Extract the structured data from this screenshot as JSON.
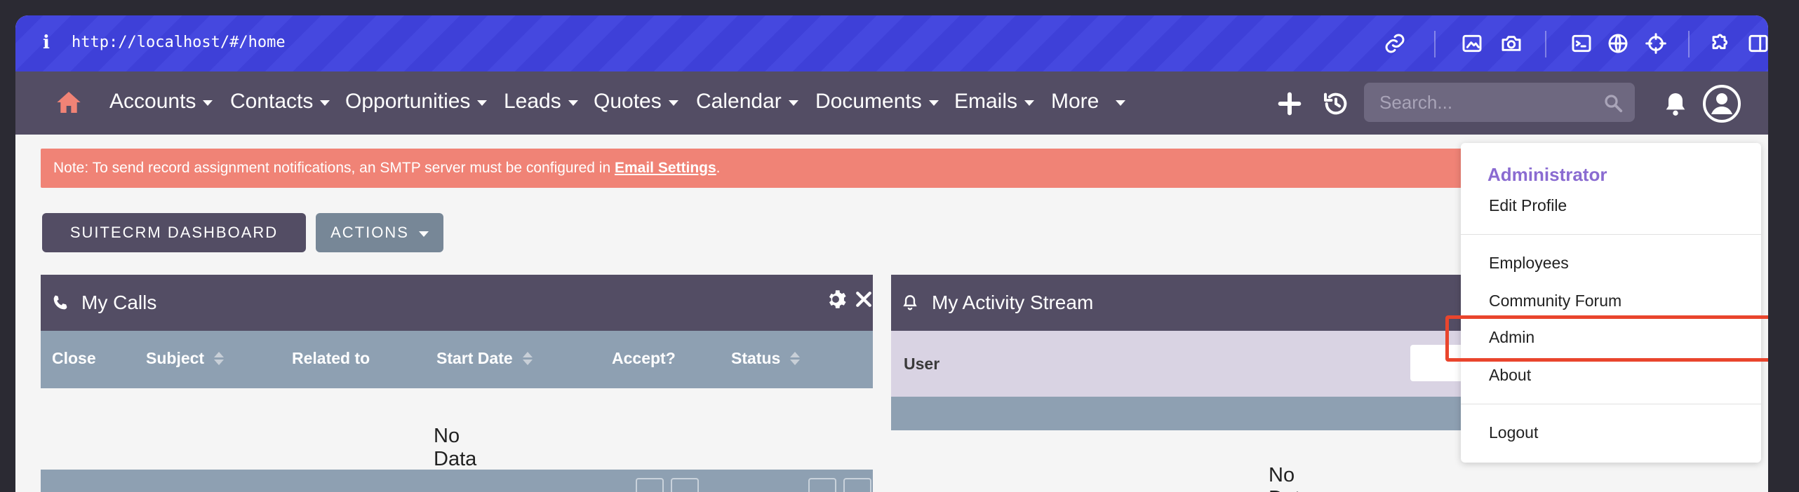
{
  "browser": {
    "url": "http://localhost/#/home"
  },
  "nav": {
    "items": [
      {
        "label": "Accounts"
      },
      {
        "label": "Contacts"
      },
      {
        "label": "Opportunities"
      },
      {
        "label": "Leads"
      },
      {
        "label": "Quotes"
      },
      {
        "label": "Calendar"
      },
      {
        "label": "Documents"
      },
      {
        "label": "Emails"
      },
      {
        "label": "More"
      }
    ],
    "search_placeholder": "Search..."
  },
  "notice": {
    "text": "Note: To send record assignment notifications, an SMTP server must be configured in ",
    "link": "Email Settings",
    "suffix": "."
  },
  "buttons": {
    "dashboard": "SUITECRM DASHBOARD",
    "actions": "ACTIONS"
  },
  "dashlets": {
    "calls": {
      "title": "My Calls",
      "columns": [
        "Close",
        "Subject",
        "Related to",
        "Start Date",
        "Accept?",
        "Status"
      ],
      "empty": "No Data"
    },
    "activity": {
      "title": "My Activity Stream",
      "column": "User",
      "empty": "No Data"
    }
  },
  "user_menu": {
    "header": "Administrator",
    "items": [
      "Edit Profile",
      "Employees",
      "Community Forum",
      "Admin",
      "About",
      "Logout"
    ]
  },
  "colors": {
    "browser_bar": "#3e40d8",
    "nav_bg": "#534d64",
    "notice_bg": "#f08376",
    "home_icon": "#f08376",
    "accent_purple": "#8a6bd1",
    "highlight": "#e9452d"
  }
}
